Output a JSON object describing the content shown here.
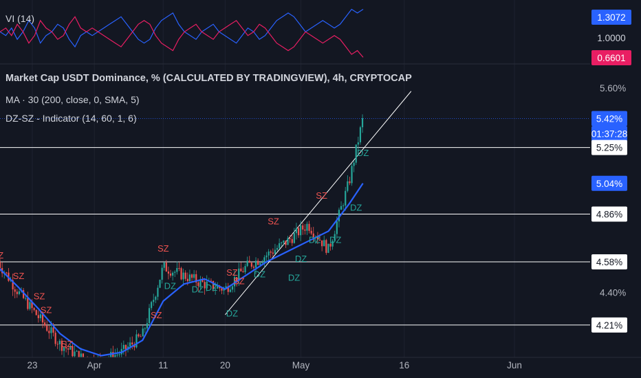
{
  "legend": {
    "main": "Market Cap USDT Dominance, % (CALCULATED BY TRADINGVIEW), 4h, CRYPTOCAP",
    "ma": "MA · 30 (200, close, 0, SMA, 5)",
    "dz": "DZ-SZ - Indicator (14, 60, 1, 6)",
    "vi": "VI (14)"
  },
  "colors": {
    "background": "#131722",
    "up": "#26a69a",
    "down": "#ef5350",
    "ma": "#2962ff",
    "vi_plus": "#2962ff",
    "vi_minus": "#e91e63",
    "level_line": "#ffffff",
    "dz_label": "#26a69a",
    "sz_label": "#ef5350"
  },
  "chart_data": [
    {
      "type": "line",
      "title": "VI (14)",
      "y_badges": [
        {
          "label": "1.3072",
          "style": "blue"
        },
        {
          "label": "1.0000",
          "style": "plain"
        },
        {
          "label": "0.6601",
          "style": "pink"
        }
      ],
      "series": [
        {
          "name": "VI+",
          "values": [
            1.0,
            0.95,
            1.05,
            0.9,
            1.0,
            1.15,
            1.05,
            0.85,
            0.95,
            1.0,
            1.1,
            1.05,
            0.9,
            0.8,
            0.95,
            1.0,
            0.95,
            1.0,
            1.05,
            1.1,
            1.15,
            1.2,
            1.1,
            1.0,
            0.9,
            0.85,
            0.9,
            1.05,
            1.15,
            1.2,
            1.25,
            1.1,
            1.0,
            0.95,
            0.9,
            1.0,
            1.05,
            1.1,
            1.0,
            0.95,
            0.9,
            0.85,
            0.95,
            1.05,
            1.0,
            0.9,
            0.95,
            1.05,
            1.15,
            1.2,
            1.25,
            1.2,
            1.1,
            1.0,
            1.05,
            1.1,
            1.15,
            1.1,
            1.05,
            1.1,
            1.2,
            1.3,
            1.25,
            1.3
          ]
        },
        {
          "name": "VI-",
          "values": [
            1.0,
            1.05,
            0.95,
            1.1,
            1.0,
            0.85,
            0.95,
            1.15,
            1.05,
            1.0,
            0.9,
            0.95,
            1.1,
            1.2,
            1.05,
            1.0,
            1.05,
            1.0,
            0.95,
            0.9,
            0.85,
            0.8,
            0.9,
            1.0,
            1.1,
            1.15,
            1.1,
            0.95,
            0.85,
            0.8,
            0.75,
            0.9,
            1.0,
            1.05,
            1.1,
            1.0,
            0.95,
            0.9,
            1.0,
            1.05,
            1.1,
            1.15,
            1.05,
            0.95,
            1.0,
            1.1,
            1.05,
            0.95,
            0.85,
            0.8,
            0.75,
            0.8,
            0.9,
            1.0,
            0.95,
            0.9,
            0.85,
            0.9,
            0.95,
            0.9,
            0.8,
            0.7,
            0.75,
            0.66
          ]
        }
      ]
    },
    {
      "type": "line",
      "title": "Market Cap USDT Dominance, % (CALCULATED BY TRADINGVIEW), 4h, CRYPTOCAP",
      "ylim": [
        4.02,
        5.72
      ],
      "x_tick_labels": [
        "23",
        "Apr",
        "11",
        "20",
        "May",
        "16",
        "Jun"
      ],
      "y_ticks": [
        "5.60%",
        "5.42%",
        "5.25%",
        "5.04%",
        "4.86%",
        "4.58%",
        "4.40%",
        "4.21%"
      ],
      "price_badges": [
        {
          "label": "5.42%",
          "value": 5.42,
          "style": "blue"
        },
        {
          "label": "01:37:28",
          "value": 5.4,
          "style": "blue-sub"
        },
        {
          "label": "5.25%",
          "value": 5.25,
          "style": "white"
        },
        {
          "label": "5.04%",
          "value": 5.04,
          "style": "blue"
        },
        {
          "label": "4.86%",
          "value": 4.86,
          "style": "white"
        },
        {
          "label": "4.58%",
          "value": 4.58,
          "style": "white"
        },
        {
          "label": "4.21%",
          "value": 4.21,
          "style": "white"
        }
      ],
      "horizontal_levels": [
        5.25,
        4.86,
        4.58,
        4.21
      ],
      "series": [
        {
          "name": "Price",
          "x": [
            "Mar 18",
            "Mar 21",
            "Mar 24",
            "Mar 27",
            "Mar 30",
            "Apr 2",
            "Apr 5",
            "Apr 8",
            "Apr 11",
            "Apr 14",
            "Apr 17",
            "Apr 20",
            "Apr 23",
            "Apr 26",
            "Apr 29",
            "May 2",
            "May 5",
            "May 8",
            "May 10"
          ],
          "values": [
            4.58,
            4.4,
            4.25,
            4.1,
            4.02,
            4.0,
            4.05,
            4.15,
            4.55,
            4.5,
            4.45,
            4.42,
            4.55,
            4.62,
            4.7,
            4.8,
            4.65,
            5.05,
            5.42
          ]
        },
        {
          "name": "MA",
          "x": [
            "Mar 18",
            "Mar 21",
            "Mar 24",
            "Mar 27",
            "Mar 30",
            "Apr 2",
            "Apr 5",
            "Apr 8",
            "Apr 11",
            "Apr 14",
            "Apr 17",
            "Apr 20",
            "Apr 23",
            "Apr 26",
            "Apr 29",
            "May 2",
            "May 5",
            "May 8",
            "May 10"
          ],
          "values": [
            4.55,
            4.43,
            4.3,
            4.16,
            4.07,
            4.03,
            4.05,
            4.12,
            4.35,
            4.45,
            4.48,
            4.42,
            4.5,
            4.58,
            4.64,
            4.7,
            4.76,
            4.92,
            5.04
          ]
        }
      ],
      "annotations": [
        {
          "text": "SZ",
          "x": "Mar 18",
          "y": 4.6,
          "kind": "sz"
        },
        {
          "text": "SZ",
          "x": "Mar 21",
          "y": 4.48,
          "kind": "sz"
        },
        {
          "text": "SZ",
          "x": "Mar 24",
          "y": 4.36,
          "kind": "sz"
        },
        {
          "text": "SZ",
          "x": "Mar 25",
          "y": 4.28,
          "kind": "sz"
        },
        {
          "text": "SZ",
          "x": "Mar 28",
          "y": 4.08,
          "kind": "sz"
        },
        {
          "text": "SZ",
          "x": "Apr 11",
          "y": 4.64,
          "kind": "sz"
        },
        {
          "text": "SZ",
          "x": "Apr 10",
          "y": 4.25,
          "kind": "sz"
        },
        {
          "text": "DZ",
          "x": "Apr 12",
          "y": 4.42,
          "kind": "dz"
        },
        {
          "text": "DZ",
          "x": "Apr 16",
          "y": 4.4,
          "kind": "dz"
        },
        {
          "text": "DZ",
          "x": "Apr 18",
          "y": 4.41,
          "kind": "dz"
        },
        {
          "text": "SZ",
          "x": "Apr 21",
          "y": 4.5,
          "kind": "sz"
        },
        {
          "text": "SZ",
          "x": "Apr 22",
          "y": 4.45,
          "kind": "sz"
        },
        {
          "text": "DZ",
          "x": "Apr 21",
          "y": 4.26,
          "kind": "dz"
        },
        {
          "text": "DZ",
          "x": "Apr 25",
          "y": 4.49,
          "kind": "dz"
        },
        {
          "text": "SZ",
          "x": "Apr 27",
          "y": 4.8,
          "kind": "sz"
        },
        {
          "text": "DZ",
          "x": "Apr 30",
          "y": 4.47,
          "kind": "dz"
        },
        {
          "text": "DZ",
          "x": "May 1",
          "y": 4.58,
          "kind": "dz"
        },
        {
          "text": "DZ",
          "x": "May 3",
          "y": 4.69,
          "kind": "dz"
        },
        {
          "text": "SZ",
          "x": "May 4",
          "y": 4.95,
          "kind": "sz"
        },
        {
          "text": "DZ",
          "x": "May 6",
          "y": 4.69,
          "kind": "dz"
        },
        {
          "text": "DZ",
          "x": "May 9",
          "y": 4.88,
          "kind": "dz"
        },
        {
          "text": "DZ",
          "x": "May 10",
          "y": 5.2,
          "kind": "dz"
        }
      ],
      "trendline": {
        "from": {
          "x": "Apr 20",
          "y": 4.27
        },
        "to": {
          "x": "May 17",
          "y": 5.58
        }
      }
    }
  ]
}
